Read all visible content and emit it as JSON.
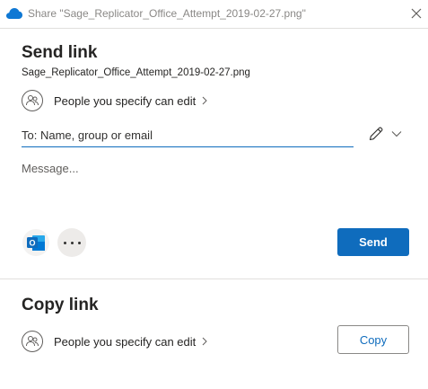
{
  "window": {
    "title": "Share \"Sage_Replicator_Office_Attempt_2019-02-27.png\"",
    "app_icon": "onedrive-cloud-icon",
    "close_icon": "close-icon"
  },
  "send_link": {
    "heading": "Send link",
    "filename": "Sage_Replicator_Office_Attempt_2019-02-27.png",
    "permission_label": "People you specify can edit",
    "to_placeholder": "To: Name, group or email",
    "to_value": "",
    "message_placeholder": "Message...",
    "message_value": "",
    "send_label": "Send"
  },
  "copy_link": {
    "heading": "Copy link",
    "permission_label": "People you specify can edit",
    "copy_label": "Copy"
  },
  "colors": {
    "accent": "#0f6cbd",
    "cloud": "#0f78d4",
    "outlook": "#0f6cbd",
    "text": "#252423",
    "muted": "#8a8886",
    "divider": "#e1dfdd"
  }
}
